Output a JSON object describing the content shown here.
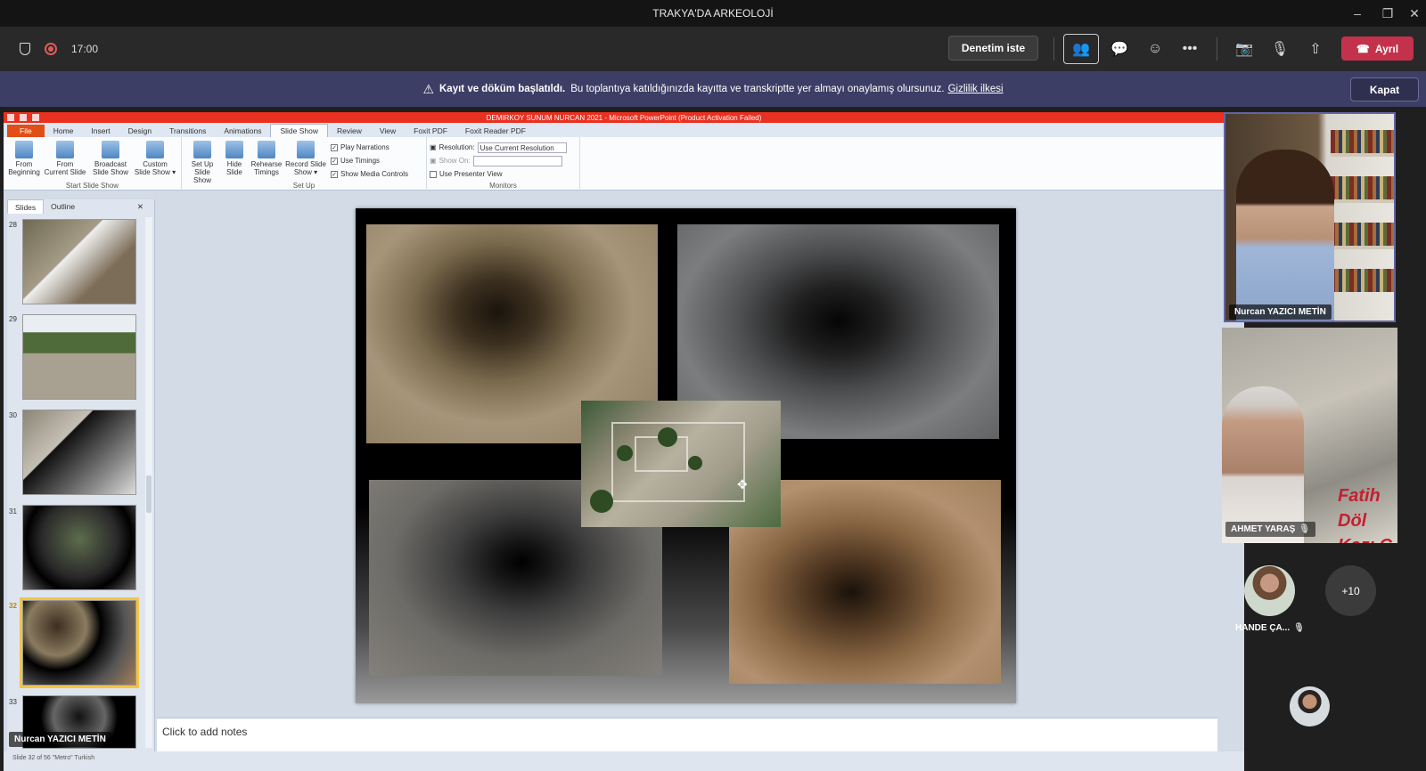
{
  "window": {
    "title": "TRAKYA'DA ARKEOLOJİ"
  },
  "meeting": {
    "time": "17:00",
    "request_control": "Denetim iste",
    "leave": "Ayrıl"
  },
  "banner": {
    "bold": "Kayıt ve döküm başlatıldı.",
    "text": "Bu toplantıya katıldığınızda kayıtta ve transkriptte yer almayı onaylamış olursunuz.",
    "link": "Gizlilik ilkesi",
    "close": "Kapat"
  },
  "ppt": {
    "title": "DEMIRKOY SUNUM NURCAN 2021  -  Microsoft PowerPoint (Product Activation Failed)",
    "tabs": [
      "File",
      "Home",
      "Insert",
      "Design",
      "Transitions",
      "Animations",
      "Slide Show",
      "Review",
      "View",
      "Foxit PDF",
      "Foxit Reader PDF"
    ],
    "ribbon": {
      "start": {
        "label": "Start Slide Show",
        "buttons": [
          [
            "From",
            "Beginning"
          ],
          [
            "From",
            "Current Slide"
          ],
          [
            "Broadcast",
            "Slide Show"
          ],
          [
            "Custom",
            "Slide Show ▾"
          ]
        ]
      },
      "setup": {
        "label": "Set Up",
        "buttons": [
          [
            "Set Up",
            "Slide Show"
          ],
          [
            "Hide",
            "Slide"
          ],
          [
            "Rehearse",
            "Timings"
          ],
          [
            "Record Slide",
            "Show ▾"
          ]
        ],
        "checks": [
          "Play Narrations",
          "Use Timings",
          "Show Media Controls"
        ]
      },
      "monitors": {
        "label": "Monitors",
        "resolution_label": "Resolution:",
        "resolution_value": "Use Current Resolution",
        "show_on": "Show On:",
        "presenter_view": "Use Presenter View"
      }
    },
    "panel_tabs": [
      "Slides",
      "Outline"
    ],
    "slide_numbers": [
      "28",
      "29",
      "30",
      "31",
      "32",
      "33"
    ],
    "notes_placeholder": "Click to add notes",
    "status": "Slide 32 of 56   \"Metro\"   Turkish",
    "presenter_tag": "Nurcan YAZICI METİN"
  },
  "participants": {
    "p1": "Nurcan YAZICI METİN",
    "p2": "AHMET YARAŞ",
    "p2_poster": [
      "Fatih Döl",
      "Kazı Ç"
    ],
    "p3": "HANDE ÇA...",
    "more": "+10"
  }
}
